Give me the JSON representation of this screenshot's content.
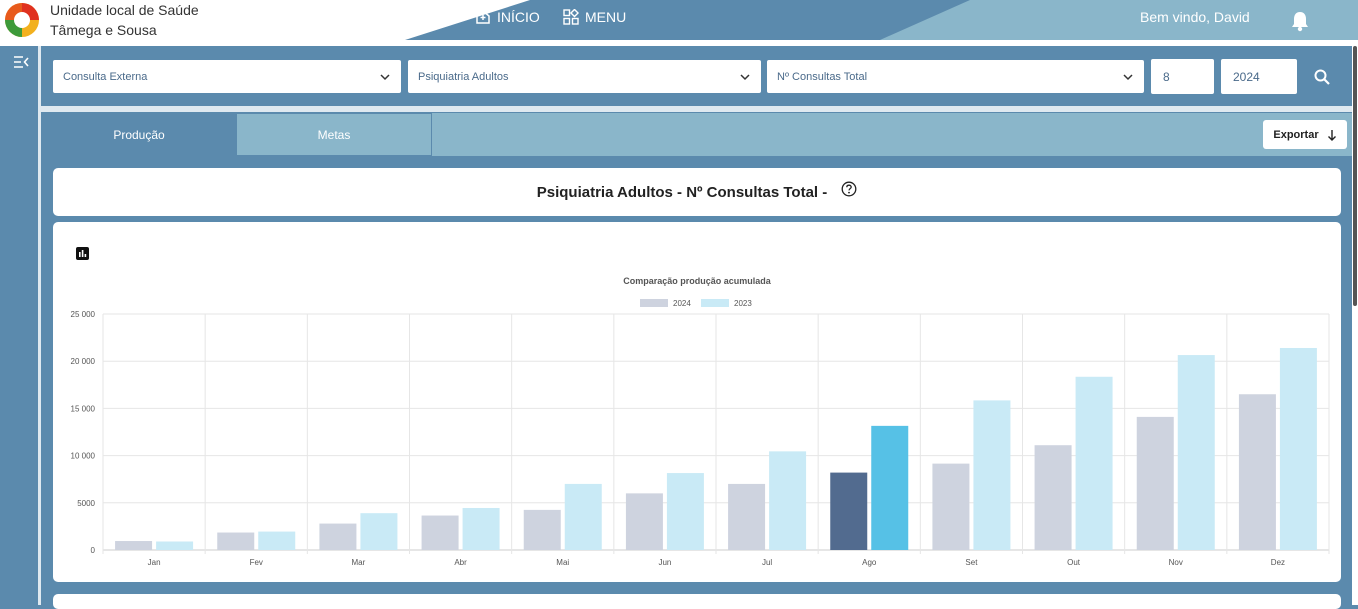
{
  "header": {
    "brand_line1": "Unidade local de Saúde",
    "brand_line2": "Tâmega e Sousa",
    "nav_home": "INÍCIO",
    "nav_menu": "MENU",
    "welcome": "Bem vindo, David",
    "icons": [
      "logo-icon",
      "home-icon",
      "grid-icon",
      "bell-icon"
    ]
  },
  "filters": {
    "type": "Consulta Externa",
    "specialty": "Psiquiatria Adultos",
    "indicator": "Nº Consultas Total",
    "month": "8",
    "year": "2024"
  },
  "tabs": [
    {
      "label": "Produção",
      "active": true
    },
    {
      "label": "Metas",
      "active": false
    }
  ],
  "export_label": "Exportar",
  "page_title": "Psiquiatria Adultos - Nº Consultas Total -",
  "colors": {
    "primary": "#5b8aad",
    "secondary": "#8ab6ca",
    "series_2024": "#ced3df",
    "series_2023": "#c9eaf6",
    "highlight_2024": "#526b8f",
    "highlight_2023": "#56c1e6"
  },
  "chart_data": {
    "type": "bar",
    "title": "Comparação produção acumulada",
    "categories": [
      "Jan",
      "Fev",
      "Mar",
      "Abr",
      "Mai",
      "Jun",
      "Jul",
      "Ago",
      "Set",
      "Out",
      "Nov",
      "Dez"
    ],
    "series": [
      {
        "name": "2024",
        "values": [
          950,
          1850,
          2800,
          3650,
          4250,
          6000,
          7000,
          8200,
          9150,
          11100,
          14100,
          16500
        ]
      },
      {
        "name": "2023",
        "values": [
          900,
          1950,
          3900,
          4450,
          7000,
          8150,
          10450,
          13150,
          15850,
          18350,
          20650,
          21400
        ]
      }
    ],
    "highlight_category": "Ago",
    "ylim": [
      0,
      25000
    ],
    "yticks": [
      0,
      5000,
      10000,
      15000,
      20000,
      25000
    ],
    "ytick_labels": [
      "0",
      "5000",
      "10 000",
      "15 000",
      "20 000",
      "25 000"
    ],
    "grid": true,
    "legend_position": "top"
  }
}
